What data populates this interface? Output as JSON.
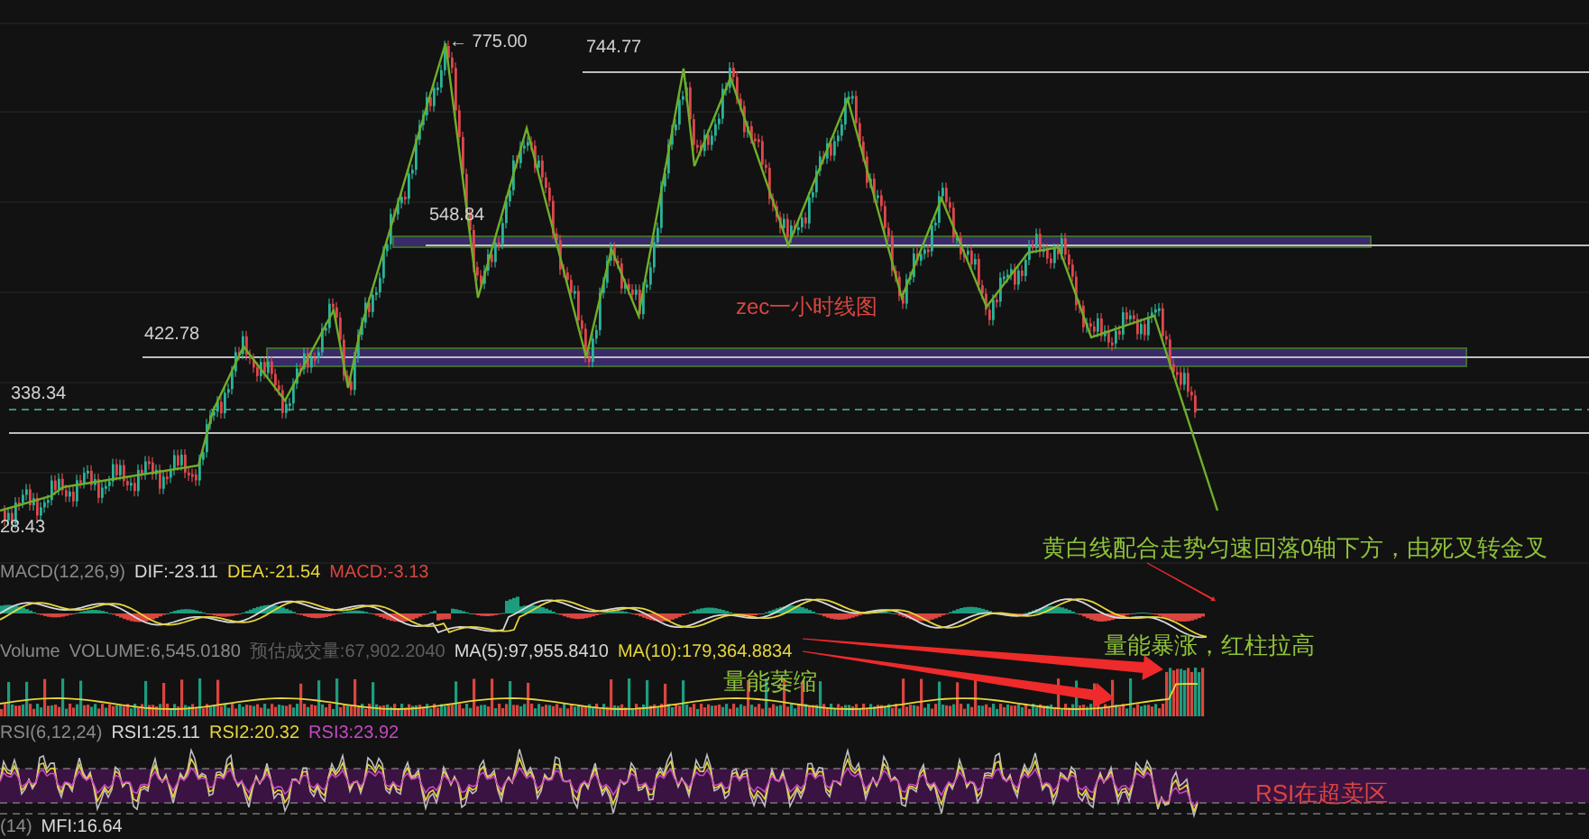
{
  "main_chart": {
    "price_labels": [
      "← 775.00",
      "744.77",
      "548.84",
      "422.78",
      "338.34",
      "28.43"
    ],
    "title": "zec一小时线图"
  },
  "macd": {
    "label": "MACD(12,26,9)",
    "dif": "DIF:-23.11",
    "dea": "DEA:-21.54",
    "macd": "MACD:-3.13"
  },
  "volume": {
    "label": "Volume",
    "volume": "VOLUME:6,545.0180",
    "estimate": "预估成交量:67,902.2040",
    "ma5": "MA(5):97,955.8410",
    "ma10": "MA(10):179,364.8834"
  },
  "rsi": {
    "label": "RSI(6,12,24)",
    "rsi1": "RSI1:25.11",
    "rsi2": "RSI2:20.32",
    "rsi3": "RSI3:23.92"
  },
  "mfi": {
    "label": "(14)",
    "value": "MFI:16.64"
  },
  "annotations": [
    {
      "text": "黄白线配合走势匀速回落0轴下方，由死叉转金叉",
      "color": "#8fc23a"
    },
    {
      "text": "量能暴涨，红柱拉高",
      "color": "#8fc23a"
    },
    {
      "text": "量能萎缩",
      "color": "#8fc23a"
    },
    {
      "text": "RSI在超卖区",
      "color": "#d9453f"
    }
  ]
}
